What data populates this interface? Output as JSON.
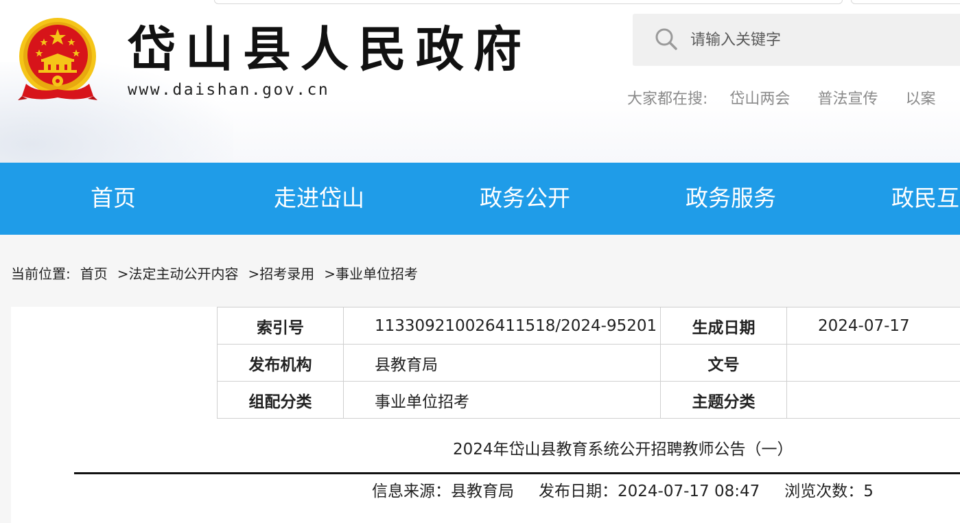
{
  "site": {
    "title": "岱山县人民政府",
    "url": "www.daishan.gov.cn"
  },
  "search": {
    "placeholder": "请输入关键字",
    "hot_label": "大家都在搜:",
    "hot_items": [
      "岱山两会",
      "普法宣传",
      "以案"
    ]
  },
  "nav": {
    "items": [
      "首页",
      "走进岱山",
      "政务公开",
      "政务服务",
      "政民互"
    ]
  },
  "breadcrumb": {
    "label": "当前位置:",
    "items": [
      "首页",
      ">法定主动公开内容",
      ">招考录用",
      ">事业单位招考"
    ]
  },
  "meta": {
    "index_label": "索引号",
    "index_value": "113309210026411518/2024-95201",
    "date_label": "生成日期",
    "date_value": "2024-07-17",
    "org_label": "发布机构",
    "org_value": "县教育局",
    "docno_label": "文号",
    "docno_value": "",
    "category_label": "组配分类",
    "category_value": "事业单位招考",
    "topic_label": "主题分类",
    "topic_value": ""
  },
  "article": {
    "title": "2024年岱山县教育系统公开招聘教师公告（一）",
    "source": "信息来源：县教育局",
    "publish": "发布日期：2024-07-17 08:47",
    "views": "浏览次数：5"
  },
  "colors": {
    "nav_bg": "#1f9ce8",
    "emblem_red": "#d7141a",
    "emblem_gold": "#f5c518"
  }
}
